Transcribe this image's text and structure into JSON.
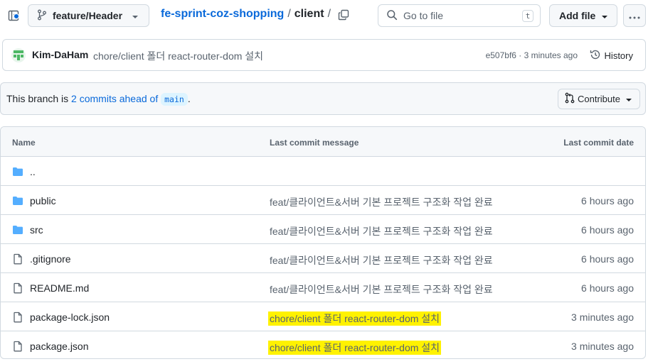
{
  "header": {
    "branch": "feature/Header",
    "repo": "fe-sprint-coz-shopping",
    "path_sep1": "/",
    "path_dir": "client",
    "path_sep2": "/",
    "search_placeholder": "Go to file",
    "search_shortcut": "t",
    "add_file_label": "Add file"
  },
  "latest_commit": {
    "author": "Kim-DaHam",
    "message": "chore/client 폴더 react-router-dom 설치",
    "meta": "e507bf6 · 3 minutes ago",
    "history_label": "History"
  },
  "ahead": {
    "prefix": "This branch is ",
    "link": "2 commits ahead of",
    "base": "main",
    "suffix": ".",
    "contribute_label": "Contribute"
  },
  "table": {
    "headers": {
      "name": "Name",
      "message": "Last commit message",
      "date": "Last commit date"
    },
    "rows": [
      {
        "name": "..",
        "type": "folder",
        "message": "",
        "date": "",
        "highlight": false
      },
      {
        "name": "public",
        "type": "folder",
        "message": "feat/클라이언트&서버 기본 프로젝트 구조화 작업 완료",
        "date": "6 hours ago",
        "highlight": false
      },
      {
        "name": "src",
        "type": "folder",
        "message": "feat/클라이언트&서버 기본 프로젝트 구조화 작업 완료",
        "date": "6 hours ago",
        "highlight": false
      },
      {
        "name": ".gitignore",
        "type": "file",
        "message": "feat/클라이언트&서버 기본 프로젝트 구조화 작업 완료",
        "date": "6 hours ago",
        "highlight": false
      },
      {
        "name": "README.md",
        "type": "file",
        "message": "feat/클라이언트&서버 기본 프로젝트 구조화 작업 완료",
        "date": "6 hours ago",
        "highlight": false
      },
      {
        "name": "package-lock.json",
        "type": "file",
        "message": "chore/client 폴더 react-router-dom 설치",
        "date": "3 minutes ago",
        "highlight": true
      },
      {
        "name": "package.json",
        "type": "file",
        "message": "chore/client 폴더 react-router-dom 설치",
        "date": "3 minutes ago",
        "highlight": true
      }
    ]
  },
  "colors": {
    "link": "#0969da",
    "folder": "#54aeff",
    "highlight": "#fff200",
    "muted": "#59636e",
    "border": "#d1d9e0"
  },
  "icons": {
    "sidebar": "sidebar-expand-icon",
    "branch": "git-branch-icon",
    "copy": "copy-icon",
    "search": "search-icon",
    "more": "kebab-horizontal-icon",
    "history": "history-icon",
    "contribute": "git-pull-request-icon",
    "folder": "folder-icon",
    "file": "file-icon"
  }
}
